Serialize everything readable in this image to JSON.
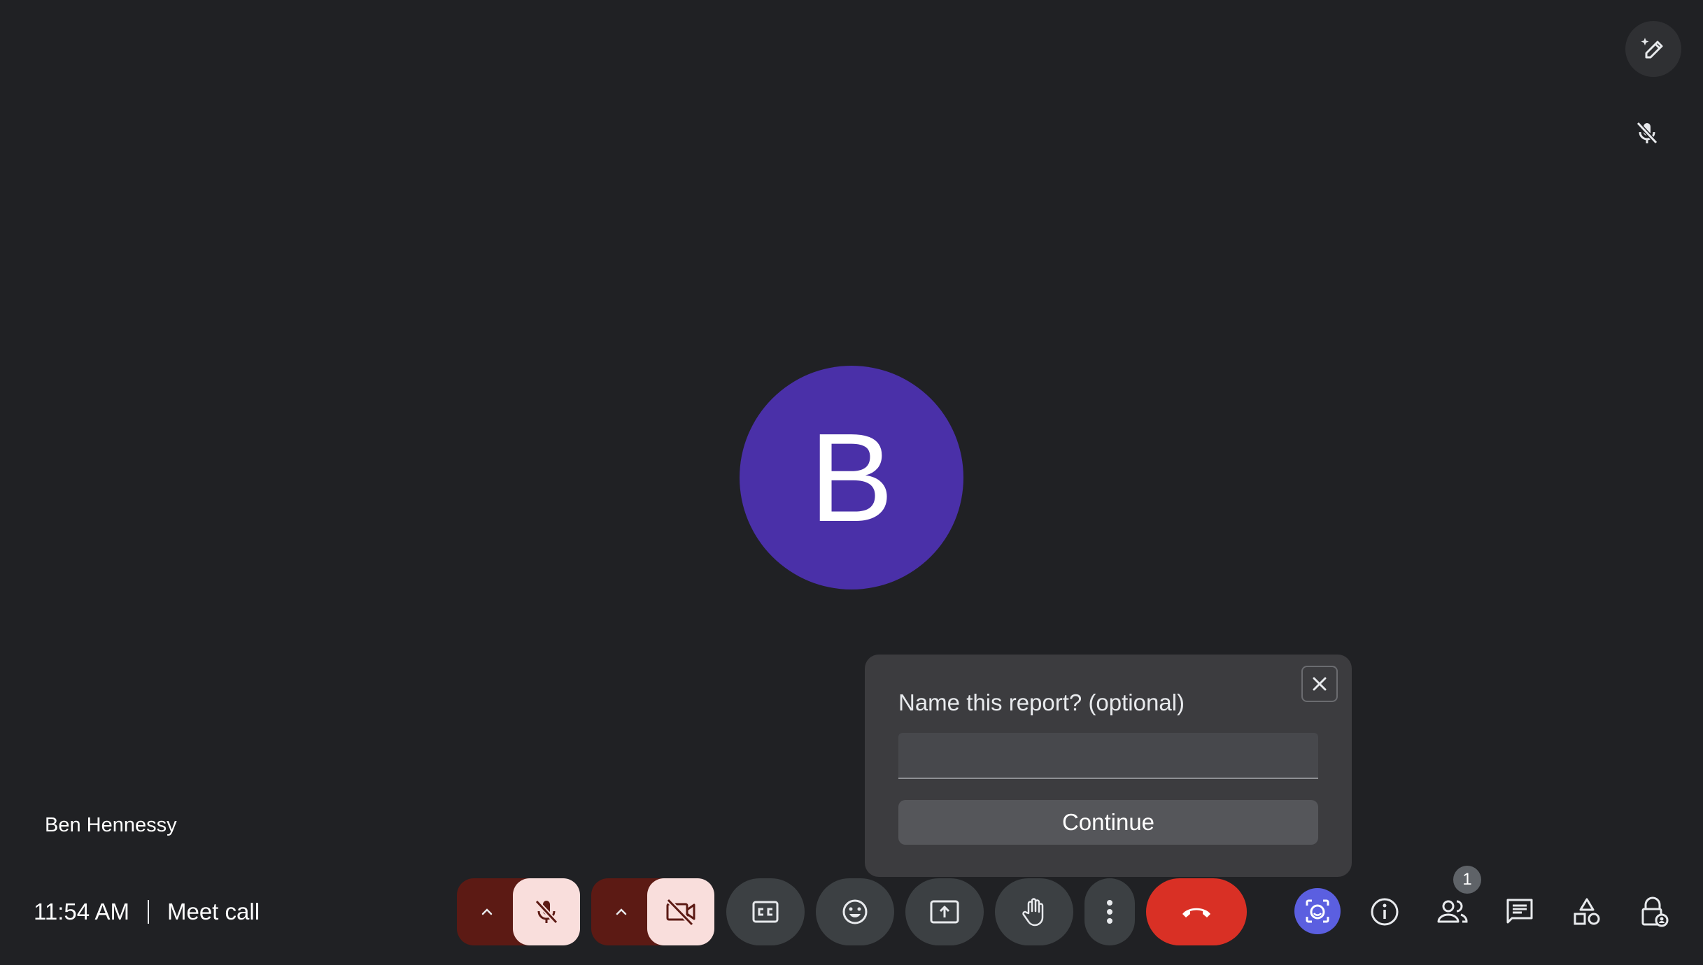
{
  "participant": {
    "initial": "B",
    "name": "Ben Hennessy",
    "avatar_color": "#4a30a8"
  },
  "meeting": {
    "time": "11:54 AM",
    "title": "Meet call"
  },
  "report_dialog": {
    "title": "Name this report? (optional)",
    "input_value": "",
    "continue_label": "Continue"
  },
  "toolbar": {
    "people_count": "1",
    "leave_color": "#d93025",
    "muted_bg_color": "#f9dedc",
    "active_effects_color": "#5b5fe0"
  },
  "icons": {
    "top_right": "pencil-sparkle-icon",
    "tile_status": "mic-off-icon",
    "controls": [
      "chevron-up-icon",
      "mic-off-icon",
      "chevron-up-icon",
      "camera-off-icon",
      "captions-icon",
      "emoji-icon",
      "present-icon",
      "raise-hand-icon",
      "more-vert-icon",
      "call-end-icon"
    ],
    "side_panel": [
      "effects-icon",
      "info-icon",
      "people-icon",
      "chat-icon",
      "activities-icon",
      "host-controls-icon"
    ]
  }
}
